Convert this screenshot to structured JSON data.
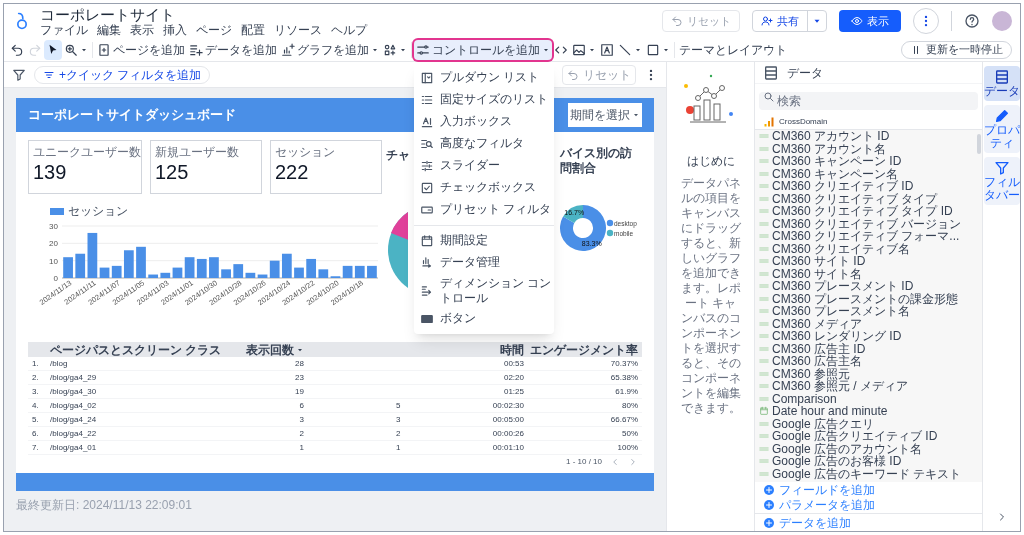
{
  "app": {
    "title": "コーポレートサイト",
    "menu": [
      "ファイル",
      "編集",
      "表示",
      "挿入",
      "ページ",
      "配置",
      "リソース",
      "ヘルプ"
    ]
  },
  "header_actions": {
    "reset": {
      "label": "リセット",
      "disabled": true
    },
    "share": {
      "label": "共有"
    },
    "view": {
      "label": "表示"
    }
  },
  "toolbar": [
    {
      "kind": "undo",
      "caret": false,
      "selected": false,
      "disabled": false,
      "open": false
    },
    {
      "kind": "redo",
      "caret": false,
      "selected": false,
      "disabled": true,
      "open": false
    },
    {
      "kind": "select",
      "caret": false,
      "selected": true,
      "disabled": false,
      "open": false
    },
    {
      "kind": "zoom",
      "caret": true,
      "selected": false,
      "disabled": false,
      "open": false
    },
    {
      "kind": "add_page",
      "label": "ページを追加",
      "caret": false,
      "selected": false,
      "disabled": false,
      "open": false
    },
    {
      "kind": "add_data",
      "label": "データを追加",
      "caret": false,
      "selected": false,
      "disabled": false,
      "open": false
    },
    {
      "kind": "add_chart",
      "label": "グラフを追加",
      "caret": true,
      "selected": false,
      "disabled": false,
      "open": false
    },
    {
      "kind": "community",
      "caret": true,
      "selected": false,
      "disabled": false,
      "open": false
    },
    {
      "kind": "add_control",
      "label": "コントロールを追加",
      "caret": true,
      "selected": false,
      "disabled": false,
      "open": true
    },
    {
      "kind": "code",
      "caret": false,
      "selected": false,
      "disabled": false,
      "open": false
    },
    {
      "kind": "image",
      "caret": true,
      "selected": false,
      "disabled": false,
      "open": false
    },
    {
      "kind": "text_box",
      "caret": false,
      "selected": false,
      "disabled": false,
      "open": false
    },
    {
      "kind": "line",
      "caret": true,
      "selected": false,
      "disabled": false,
      "open": false
    },
    {
      "kind": "shape",
      "caret": true,
      "selected": false,
      "disabled": false,
      "open": false
    },
    {
      "kind": "theme",
      "label": "テーマとレイアウト",
      "caret": false,
      "selected": false,
      "disabled": false,
      "open": false
    }
  ],
  "pause_refresh": {
    "label": "更新を一時停止"
  },
  "control_menu": {
    "groups": [
      [
        {
          "kind": "dropdown",
          "label": "プルダウン リスト"
        },
        {
          "kind": "fixed_list",
          "label": "固定サイズのリスト"
        },
        {
          "kind": "input",
          "label": "入力ボックス"
        },
        {
          "kind": "advanced",
          "label": "高度なフィルタ"
        },
        {
          "kind": "slider",
          "label": "スライダー"
        },
        {
          "kind": "checkbox",
          "label": "チェックボックス"
        },
        {
          "kind": "preset",
          "label": "プリセット フィルタ"
        }
      ],
      [
        {
          "kind": "date",
          "label": "期間設定"
        },
        {
          "kind": "data",
          "label": "データ管理"
        },
        {
          "kind": "dimension",
          "label": "ディメンション コントロール"
        },
        {
          "kind": "button",
          "label": "ボタン"
        }
      ]
    ]
  },
  "filter_bar": {
    "quick_filter": "+クイック フィルタを追加",
    "reset": {
      "label": "リセット",
      "disabled": true
    }
  },
  "report": {
    "title": "コーポレートサイトダッシュボード",
    "date_picker": {
      "placeholder": "期間を選択"
    },
    "scorecards": [
      {
        "label": "ユニークユーザー数",
        "value": "139"
      },
      {
        "label": "新規ユーザー数",
        "value": "125"
      },
      {
        "label": "セッション",
        "value": "222"
      }
    ],
    "session_chart": {
      "chart_data": {
        "type": "bar",
        "categories": [
          "2024/11/13",
          null,
          "2024/11/11",
          null,
          "2024/11/07",
          null,
          "2024/11/05",
          null,
          "2024/11/03",
          null,
          "2024/11/01",
          null,
          "2024/10/30",
          null,
          "2024/10/28",
          null,
          "2024/10/26",
          null,
          "2024/10/24",
          null,
          "2024/10/22",
          null,
          "2024/10/20",
          null,
          "2024/10/18",
          null
        ],
        "series": [
          {
            "name": "セッション",
            "color": "#4a8fe7",
            "values": [
              12,
              14,
              26,
              6,
              7,
              16,
              18,
              2,
              3,
              6,
              12,
              11,
              12,
              5,
              8,
              3,
              2,
              10,
              14,
              6,
              11,
              5,
              1,
              7,
              7,
              7
            ]
          }
        ],
        "ylim": [
          0,
          30
        ],
        "yticks": [
          0,
          10,
          20,
          30
        ]
      }
    },
    "pie_chart": {
      "title": "チャ"
    },
    "device_chart": {
      "title": "バイス別の訪問割合",
      "chart_data": {
        "type": "donut",
        "categories": [
          "desktop",
          "mobile"
        ],
        "values": [
          83.3,
          16.7
        ],
        "value_labels": [
          "83.3%",
          "16.7%"
        ],
        "legend": "right"
      }
    },
    "table": {
      "columns": {
        "page": {
          "label": "ページパスとスクリーン クラス",
          "sorted": false
        },
        "views": {
          "label": "表示回数",
          "sorted": true
        },
        "column_4": {
          "label": "時間",
          "sorted": false
        },
        "engagement": {
          "label": "エンゲージメント率",
          "sorted": false
        }
      },
      "rows": [
        {
          "index": "1.",
          "page": "/blog",
          "views": "28",
          "column_4": "00:53",
          "engagement": "70.37%"
        },
        {
          "index": "2.",
          "page": "/blog/ga4_29",
          "views": "23",
          "column_4": "02:20",
          "engagement": "65.38%"
        },
        {
          "index": "3.",
          "page": "/blog/ga4_30",
          "views": "19",
          "column_4": "01:25",
          "engagement": "61.9%"
        },
        {
          "index": "4.",
          "page": "/blog/ga4_02",
          "views": "6",
          "column_3": "5",
          "column_4": "00:02:30",
          "engagement": "80%"
        },
        {
          "index": "5.",
          "page": "/blog/ga4_24",
          "views": "3",
          "column_3": "3",
          "column_4": "00:05:00",
          "engagement": "66.67%"
        },
        {
          "index": "6.",
          "page": "/blog/ga4_22",
          "views": "2",
          "column_3": "2",
          "column_4": "00:00:26",
          "engagement": "50%"
        },
        {
          "index": "7.",
          "page": "/blog/ga4_01",
          "views": "1",
          "column_3": "1",
          "column_4": "00:01:10",
          "engagement": "100%"
        }
      ],
      "pagination": "1 - 10 / 10"
    },
    "last_updated": "最終更新日: 2024/11/13 22:09:01"
  },
  "intro": {
    "heading": "はじめに",
    "text": "データパネルの項目をキャンバスにドラッグすると、新しいグラフを追加できます。レポート キャンバスのコンポーネントを選択すると、そのコンポーネントを編集できます。"
  },
  "data_panel": {
    "title": "データ",
    "search": {
      "placeholder": "検索"
    },
    "source": "CrossDomain",
    "fields": [
      {
        "kind": "text",
        "label": "CM360 アカウント ID"
      },
      {
        "kind": "text",
        "label": "CM360 アカウント名"
      },
      {
        "kind": "text",
        "label": "CM360 キャンペーン ID"
      },
      {
        "kind": "text",
        "label": "CM360 キャンペーン名"
      },
      {
        "kind": "text",
        "label": "CM360 クリエイティブ ID"
      },
      {
        "kind": "text",
        "label": "CM360 クリエイティブ タイプ"
      },
      {
        "kind": "text",
        "label": "CM360 クリエイティブ タイプ ID"
      },
      {
        "kind": "text",
        "label": "CM360 クリエイティブ バージョン"
      },
      {
        "kind": "text",
        "label": "CM360 クリエイティブ フォーマ..."
      },
      {
        "kind": "text",
        "label": "CM360 クリエイティブ名"
      },
      {
        "kind": "text",
        "label": "CM360 サイト ID"
      },
      {
        "kind": "text",
        "label": "CM360 サイト名"
      },
      {
        "kind": "text",
        "label": "CM360 プレースメント ID"
      },
      {
        "kind": "text",
        "label": "CM360 プレースメントの課金形態"
      },
      {
        "kind": "text",
        "label": "CM360 プレースメント名"
      },
      {
        "kind": "text",
        "label": "CM360 メディア"
      },
      {
        "kind": "text",
        "label": "CM360 レンダリング ID"
      },
      {
        "kind": "text",
        "label": "CM360 広告主 ID"
      },
      {
        "kind": "text",
        "label": "CM360 広告主名"
      },
      {
        "kind": "text",
        "label": "CM360 参照元"
      },
      {
        "kind": "text",
        "label": "CM360 参照元 / メディア"
      },
      {
        "kind": "text",
        "label": "Comparison"
      },
      {
        "kind": "date",
        "label": "Date hour and minute"
      },
      {
        "kind": "text",
        "label": "Google 広告クエリ"
      },
      {
        "kind": "text",
        "label": "Google 広告クリエイティブ ID"
      },
      {
        "kind": "text",
        "label": "Google 広告のアカウント名"
      },
      {
        "kind": "text",
        "label": "Google 広告のお客様 ID"
      },
      {
        "kind": "text",
        "label": "Google 広告のキーワード テキスト"
      }
    ],
    "actions": [
      "フィールドを追加",
      "パラメータを追加"
    ],
    "add_data": "データを追加"
  },
  "side_rail": [
    {
      "kind": "data",
      "label": "データ",
      "selected": true
    },
    {
      "kind": "properties",
      "label": "プロパティ",
      "selected": false
    },
    {
      "kind": "filter",
      "label": "フィルタバー",
      "selected": false
    }
  ]
}
